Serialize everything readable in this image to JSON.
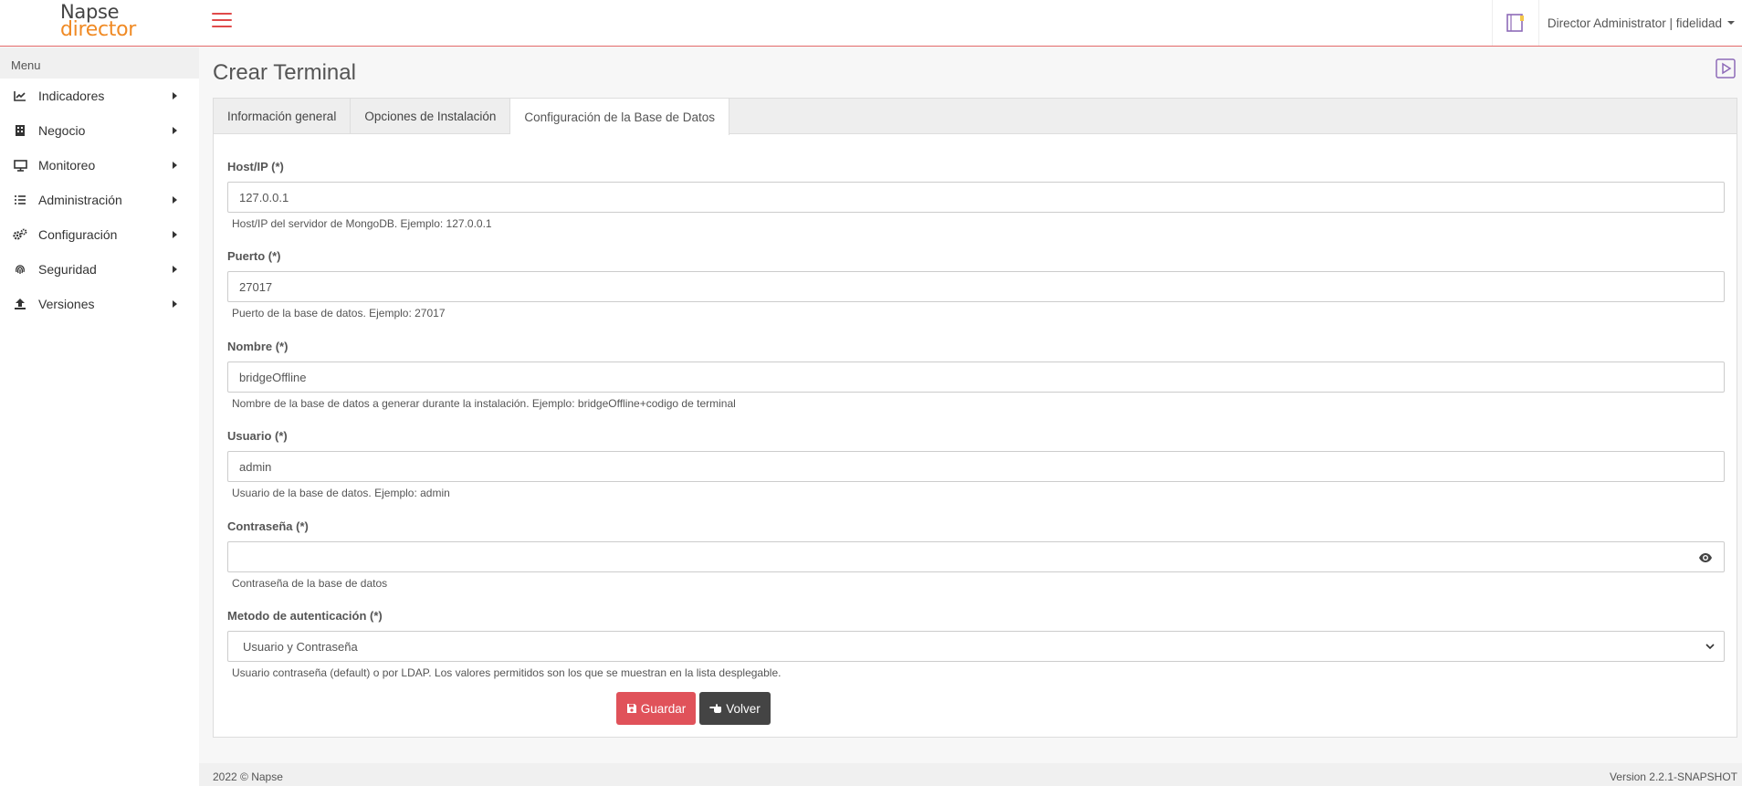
{
  "header": {
    "logo_line1": "Napse",
    "logo_line2": "director",
    "user_label": "Director Administrator | fidelidad",
    "accent_color": "#e04a4a",
    "logo_accent": "#f08a24"
  },
  "sidebar": {
    "menu_title": "Menu",
    "items": [
      {
        "label": "Indicadores",
        "icon": "chart-line-icon"
      },
      {
        "label": "Negocio",
        "icon": "building-icon"
      },
      {
        "label": "Monitoreo",
        "icon": "monitor-icon"
      },
      {
        "label": "Administración",
        "icon": "list-check-icon"
      },
      {
        "label": "Configuración",
        "icon": "gears-icon"
      },
      {
        "label": "Seguridad",
        "icon": "fingerprint-icon"
      },
      {
        "label": "Versiones",
        "icon": "upload-icon"
      }
    ]
  },
  "main": {
    "title": "Crear Terminal",
    "tabs": [
      {
        "label": "Información general",
        "active": false
      },
      {
        "label": "Opciones de Instalación",
        "active": false
      },
      {
        "label": "Configuración de la Base de Datos",
        "active": true
      }
    ],
    "fields": {
      "host": {
        "label": "Host/IP (*)",
        "value": "127.0.0.1",
        "help": "Host/IP del servidor de MongoDB. Ejemplo: 127.0.0.1"
      },
      "port": {
        "label": "Puerto (*)",
        "value": "27017",
        "help": "Puerto de la base de datos. Ejemplo: 27017"
      },
      "name": {
        "label": "Nombre (*)",
        "value": "bridgeOffline",
        "help": "Nombre de la base de datos a generar durante la instalación. Ejemplo: bridgeOffline+codigo de terminal"
      },
      "user": {
        "label": "Usuario (*)",
        "value": "admin",
        "help": "Usuario de la base de datos. Ejemplo: admin"
      },
      "password": {
        "label": "Contraseña (*)",
        "value": "",
        "help": "Contraseña de la base de datos"
      },
      "auth": {
        "label": "Metodo de autenticación (*)",
        "value": "Usuario y Contraseña",
        "help": "Usuario contraseña (default) o por LDAP. Los valores permitidos son los que se muestran en la lista desplegable."
      }
    },
    "buttons": {
      "save": "Guardar",
      "back": "Volver"
    }
  },
  "footer": {
    "copyright": "2022 © Napse",
    "version": "Version 2.2.1-SNAPSHOT"
  }
}
